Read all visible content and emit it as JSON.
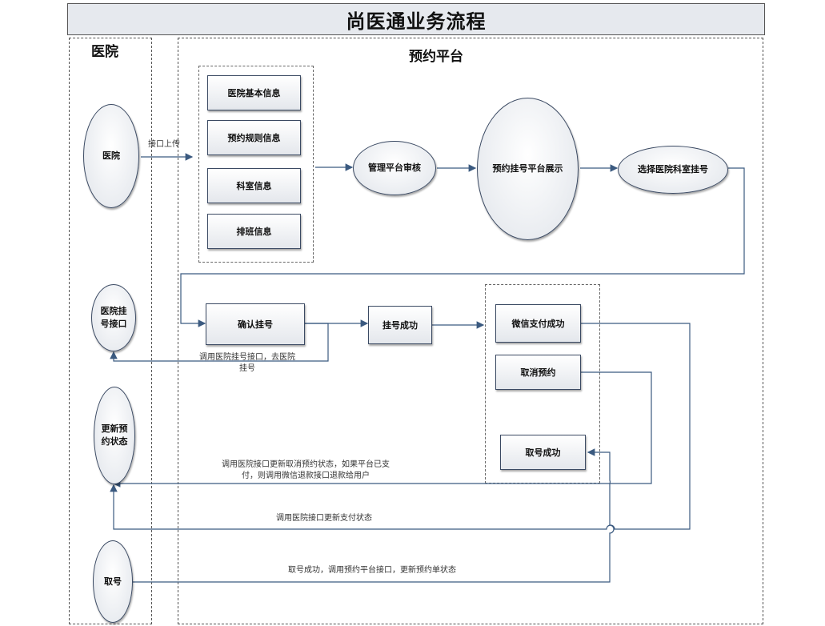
{
  "title": "尚医通业务流程",
  "lanes": {
    "hospital": "医院",
    "platform": "预约平台"
  },
  "nodes": {
    "hospital": "医院",
    "hospital_reg_interface": "医院挂\n号接口",
    "update_status": "更新预\n约状态",
    "take_number": "取号",
    "info_basic": "医院基本信息",
    "info_rules": "预约规则信息",
    "info_dept": "科室信息",
    "info_schedule": "排班信息",
    "platform_review": "管理平台审核",
    "platform_display": "预约挂号平台展示",
    "select_dept": "选择医院科室挂号",
    "confirm_reg": "确认挂号",
    "reg_success": "挂号成功",
    "wechat_pay_success": "微信支付成功",
    "cancel_booking": "取消预约",
    "take_success": "取号成功"
  },
  "labels": {
    "upload": "接口上传",
    "call_hospital_reg": "调用医院挂号接口，去医院\n挂号",
    "cancel_update": "调用医院接口更新取消预约状态，如果平台已支\n付，则调用微信退款接口退款给用户",
    "pay_update": "调用医院接口更新支付状态",
    "take_update": "取号成功，调用预约平台接口，更新预约单状态"
  }
}
